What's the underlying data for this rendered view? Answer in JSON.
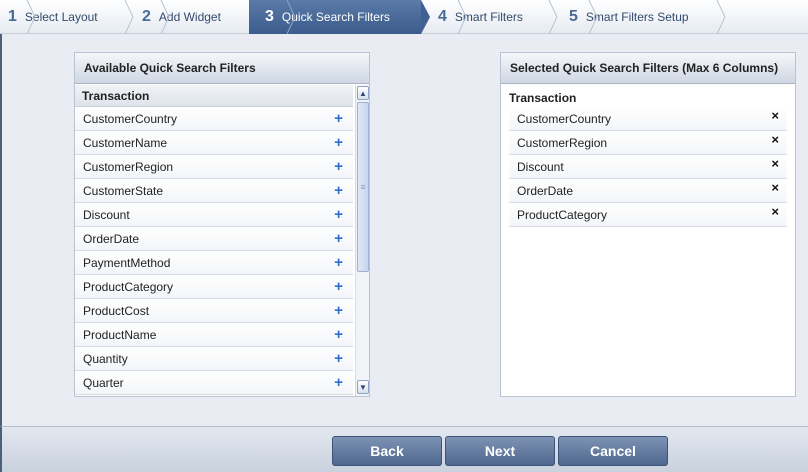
{
  "wizard": {
    "steps": [
      {
        "num": "1",
        "label": "Select Layout"
      },
      {
        "num": "2",
        "label": "Add Widget"
      },
      {
        "num": "3",
        "label": "Quick Search Filters"
      },
      {
        "num": "4",
        "label": "Smart Filters"
      },
      {
        "num": "5",
        "label": "Smart Filters Setup"
      }
    ],
    "active_index": 3
  },
  "available": {
    "title": "Available Quick Search Filters",
    "group": "Transaction",
    "items": [
      "CustomerCountry",
      "CustomerName",
      "CustomerRegion",
      "CustomerState",
      "Discount",
      "OrderDate",
      "PaymentMethod",
      "ProductCategory",
      "ProductCost",
      "ProductName",
      "Quantity",
      "Quarter"
    ],
    "add_icon": "+"
  },
  "selected": {
    "title": "Selected Quick Search Filters (Max 6 Columns)",
    "group": "Transaction",
    "items": [
      "CustomerCountry",
      "CustomerRegion",
      "Discount",
      "OrderDate",
      "ProductCategory"
    ],
    "remove_icon": "×"
  },
  "buttons": {
    "back": "Back",
    "next": "Next",
    "cancel": "Cancel"
  },
  "colors": {
    "active_step": "#4a6a96",
    "add_icon": "#2a6fd0",
    "button": "#5a7298"
  }
}
